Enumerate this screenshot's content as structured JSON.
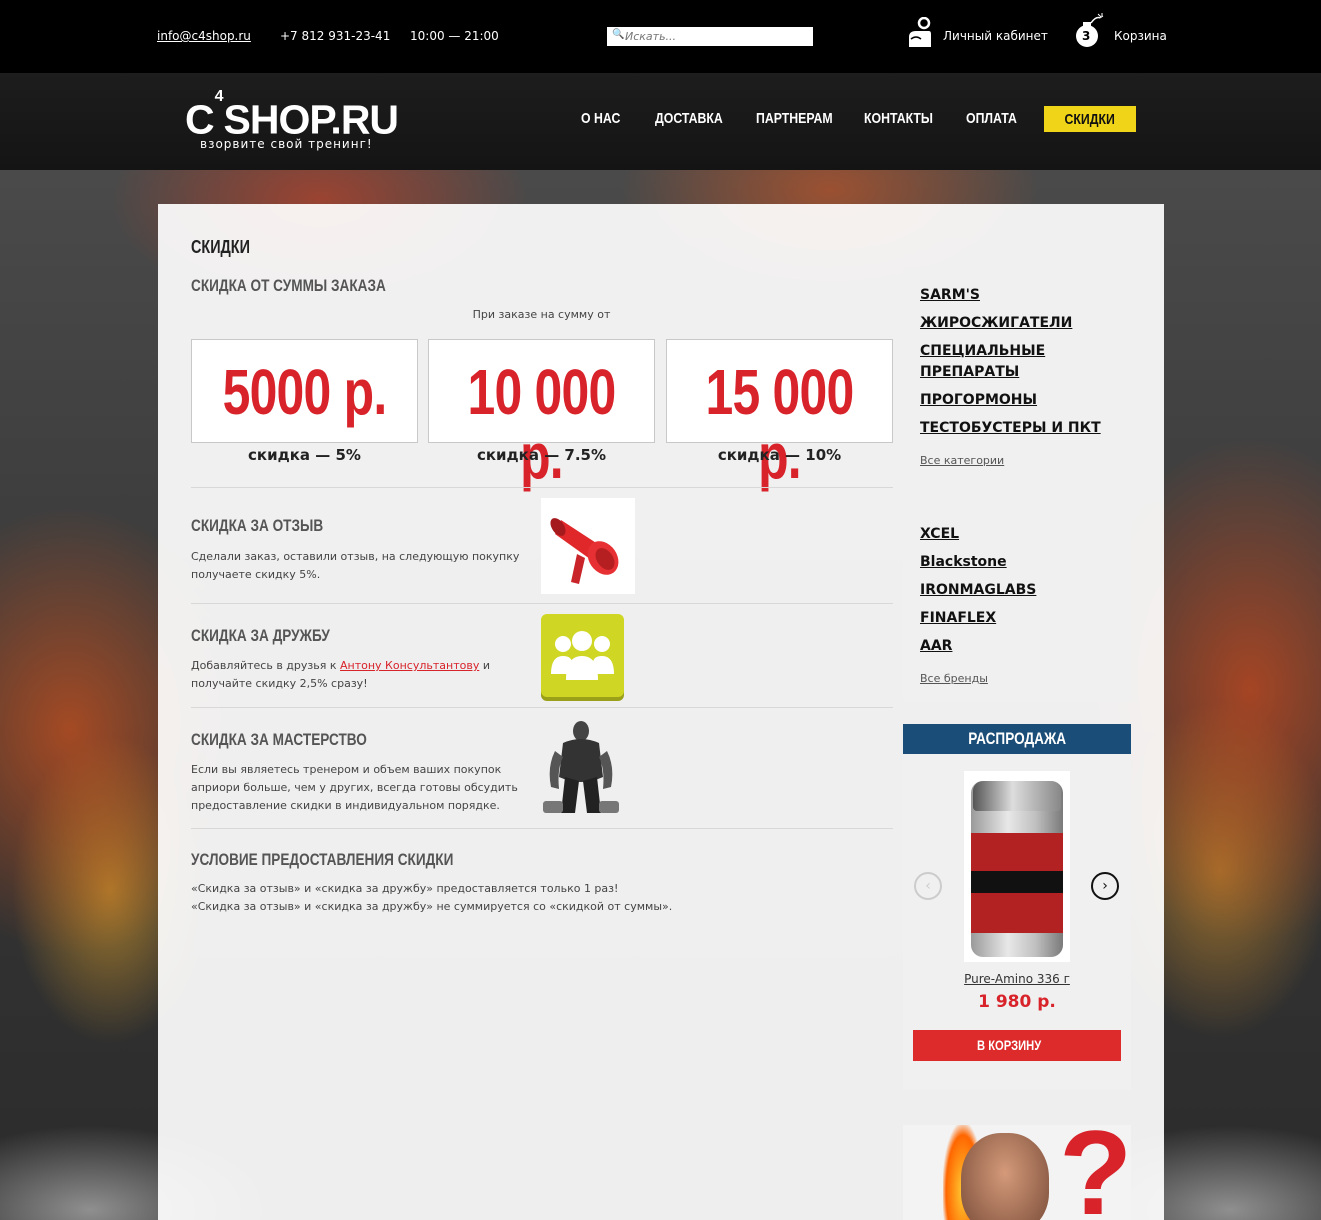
{
  "topbar": {
    "email": "info@c4shop.ru",
    "phone": "+7 812 931-23-41",
    "hours": "10:00 — 21:00",
    "search_placeholder": "Искать...",
    "account_label": "Личный кабинет",
    "cart_label": "Корзина",
    "cart_count": "3"
  },
  "header": {
    "logo_part1": "C",
    "logo_sup": "4",
    "logo_part2": "SHOP.RU",
    "tagline": "взорвите свой тренинг!",
    "nav": [
      "О НАС",
      "ДОСТАВКА",
      "ПАРТНЕРАМ",
      "КОНТАКТЫ",
      "ОПЛАТА",
      "СКИДКИ"
    ]
  },
  "main": {
    "title": "СКИДКИ",
    "sum_section": {
      "heading": "СКИДКА ОТ СУММЫ ЗАКАЗА",
      "intro": "При заказе на сумму от",
      "tiers": [
        {
          "amount": "5000 р.",
          "discount": "скидка — 5%"
        },
        {
          "amount": "10 000 р.",
          "discount": "скидка — 7.5%"
        },
        {
          "amount": "15 000 р.",
          "discount": "скидка — 10%"
        }
      ]
    },
    "review": {
      "heading": "СКИДКА ЗА ОТЗЫВ",
      "text1": "Сделали заказ, оставили отзыв, на следующую покупку",
      "text2": "получаете скидку 5%."
    },
    "friendship": {
      "heading": "СКИДКА ЗА ДРУЖБУ",
      "text_before": "Добавляйтесь в друзья к ",
      "link": "Антону Консультантову",
      "text_after": " и",
      "text2": "получайте скидку 2,5% сразу!"
    },
    "mastery": {
      "heading": "СКИДКА ЗА МАСТЕРСТВО",
      "text1": "Если вы являетесь тренером и объем ваших покупок",
      "text2": "априори больше, чем у других, всегда готовы обсудить",
      "text3": "предоставление скидки в индивидуальном порядке."
    },
    "conditions": {
      "heading": "УСЛОВИЕ ПРЕДОСТАВЛЕНИЯ СКИДКИ",
      "line1": "«Скидка за отзыв» и «скидка за дружбу» предоставляется только 1 раз!",
      "line2": "«Скидка за отзыв» и «скидка за дружбу» не суммируется со «скидкой от суммы»."
    }
  },
  "sidebar": {
    "categories": [
      "SARM'S",
      "ЖИРОСЖИГАТЕЛИ",
      "СПЕЦИАЛЬНЫЕ",
      "ПРЕПАРАТЫ",
      "ПРОГОРМОНЫ",
      "ТЕСТОБУСТЕРЫ И ПКТ"
    ],
    "all_categories": "Все категории",
    "brands": [
      "XCEL",
      "Blackstone",
      "IRONMAGLABS",
      "FINAFLEX",
      "AAR"
    ],
    "all_brands": "Все бренды",
    "sale": {
      "heading": "РАСПРОДАЖА",
      "product_name": "Pure-Amino 336 г",
      "price": "1 980 р.",
      "button": "В КОРЗИНУ"
    }
  },
  "colors": {
    "accent_red": "#d8232a",
    "nav_active": "#f0d418",
    "sale_header": "#1a4d78"
  },
  "icons": [
    "search-icon",
    "account-icon",
    "cart-bomb-icon",
    "megaphone-icon",
    "friends-icon",
    "arrow-left-icon",
    "arrow-right-icon"
  ]
}
